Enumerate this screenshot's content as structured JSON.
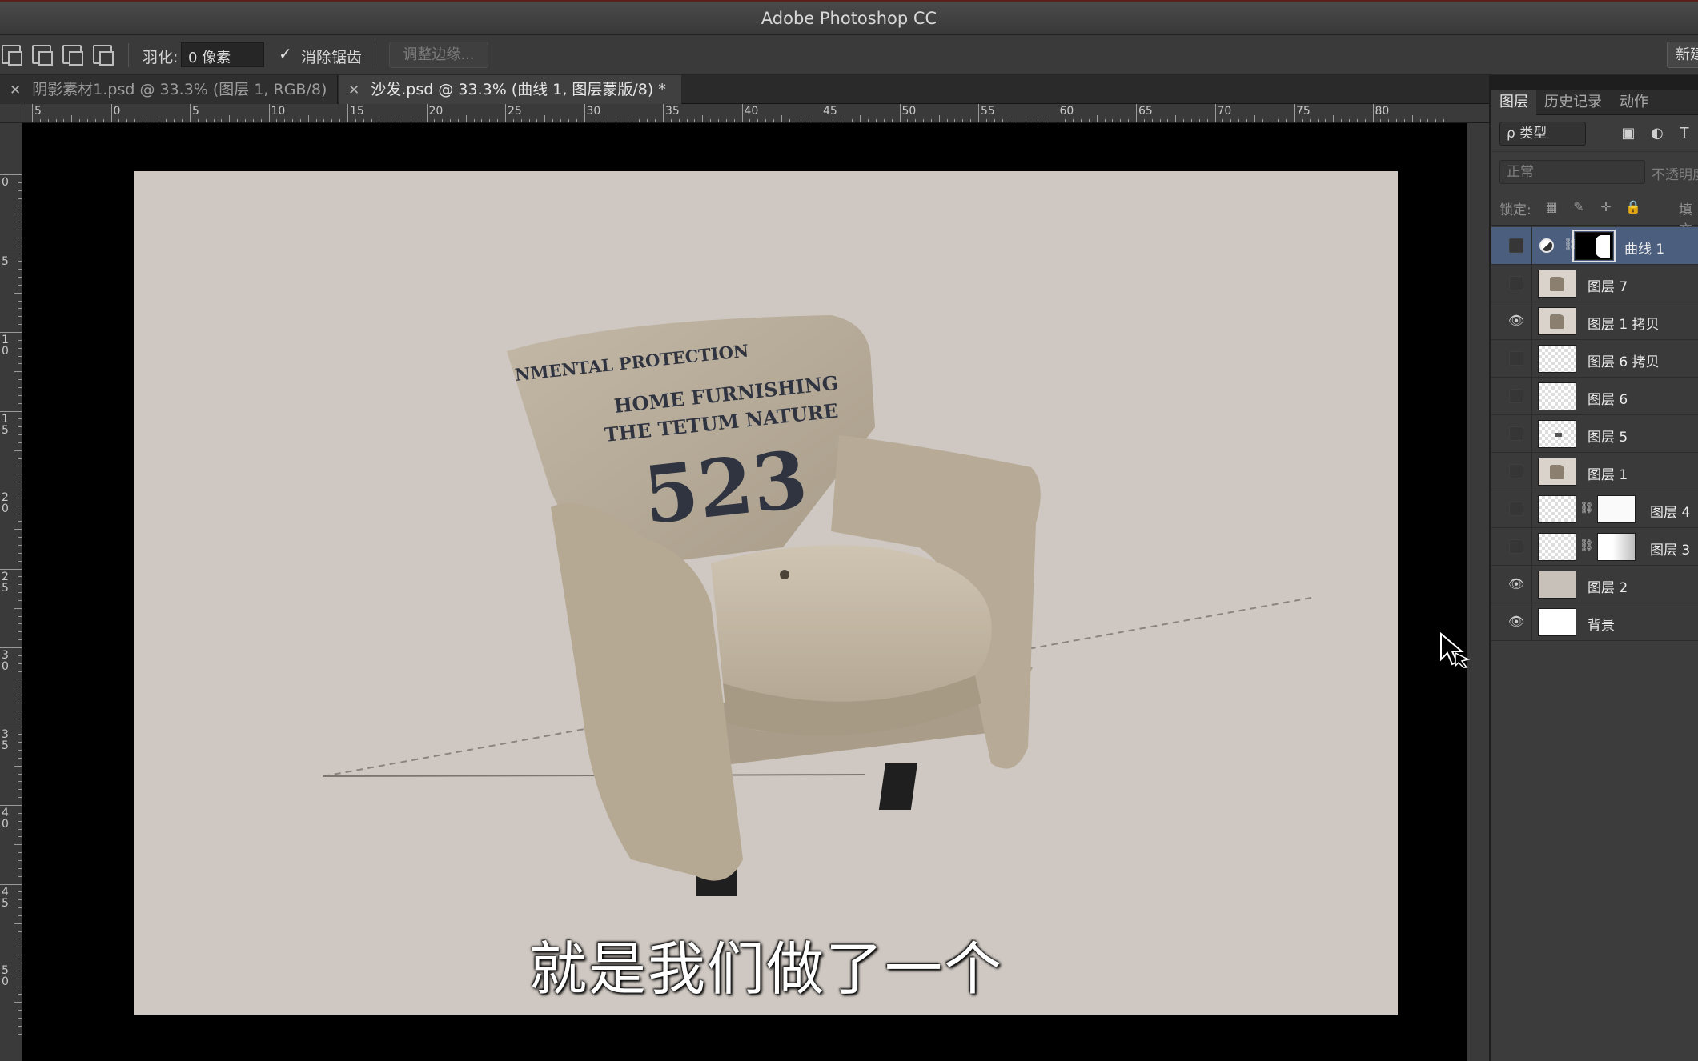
{
  "window": {
    "title": "Adobe Photoshop CC"
  },
  "options_bar": {
    "feather_label": "羽化:",
    "feather_value": "0 像素",
    "antialias_label": "消除锯齿",
    "antialias_checked": true,
    "refine_edge_label": "调整边缘...",
    "new_label": "新建"
  },
  "doc_tabs": [
    {
      "label": "阴影素材1.psd @ 33.3% (图层 1, RGB/8)",
      "active": false
    },
    {
      "label": "沙发.psd @ 33.3% (曲线 1, 图层蒙版/8) *",
      "active": true
    }
  ],
  "rulers": {
    "top_labels": [
      "5",
      "0",
      "5",
      "10",
      "15",
      "20",
      "25",
      "30",
      "35",
      "40",
      "45",
      "50",
      "55",
      "60",
      "65",
      "70",
      "75",
      "80"
    ],
    "left_labels": [
      "0",
      "5",
      "10",
      "15",
      "20",
      "25",
      "30",
      "35",
      "40",
      "45",
      "50"
    ]
  },
  "canvas": {
    "background_color": "#cfc8c2",
    "sofa_text": {
      "line1": "NMENTAL PROTECTION",
      "line2": "HOME FURNISHING",
      "line3": "THE TETUM NATURE",
      "number": "523"
    },
    "subtitle": "就是我们做了一个"
  },
  "layers_panel": {
    "tabs": [
      {
        "label": "图层",
        "active": true
      },
      {
        "label": "历史记录",
        "active": false
      },
      {
        "label": "动作",
        "active": false
      }
    ],
    "filter_label": "ρ 类型",
    "blend_mode": "正常",
    "opacity_label": "不透明度",
    "lock_label": "锁定:",
    "fill_label": "填充",
    "layers": [
      {
        "name": "曲线 1",
        "visible": false,
        "selected": true
      },
      {
        "name": "图层 7",
        "visible": false,
        "selected": false
      },
      {
        "name": "图层 1 拷贝",
        "visible": true,
        "selected": false
      },
      {
        "name": "图层 6 拷贝",
        "visible": false,
        "selected": false
      },
      {
        "name": "图层 6",
        "visible": false,
        "selected": false
      },
      {
        "name": "图层 5",
        "visible": false,
        "selected": false
      },
      {
        "name": "图层 1",
        "visible": false,
        "selected": false
      },
      {
        "name": "图层 4",
        "visible": false,
        "selected": false
      },
      {
        "name": "图层 3",
        "visible": false,
        "selected": false
      },
      {
        "name": "图层 2",
        "visible": true,
        "selected": false
      },
      {
        "name": "背景",
        "visible": true,
        "selected": false
      }
    ]
  }
}
